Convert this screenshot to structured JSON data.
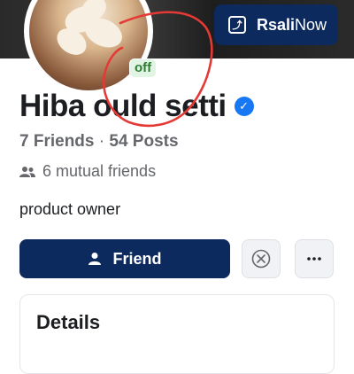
{
  "profile": {
    "status_badge": "off",
    "name": "Hiba ould setti",
    "verified_icon": "verified-badge-icon",
    "friends_count": "7 Friends",
    "separator": " · ",
    "posts_count": "54 Posts",
    "mutual_friends": "6 mutual friends",
    "bio": "product owner"
  },
  "promo": {
    "brand_bold": "Rsali",
    "brand_rest": "Now",
    "icon": "share-arrow-icon"
  },
  "actions": {
    "friend_label": "Friend",
    "remove_icon": "remove-icon",
    "more_icon": "more-icon"
  },
  "details": {
    "title": "Details"
  },
  "colors": {
    "primary": "#0c2a5e",
    "verified": "#1877f2",
    "online_green": "#2e7d32",
    "annotation_red": "#e53935"
  }
}
